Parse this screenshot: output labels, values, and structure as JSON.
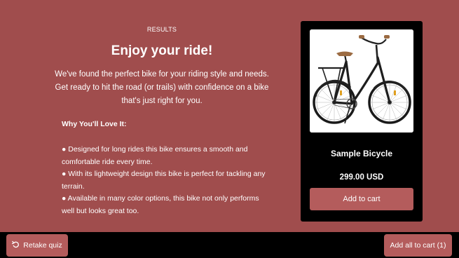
{
  "results": {
    "eyebrow": "RESULTS",
    "title": "Enjoy your ride!",
    "intro": "We've found the perfect bike for your riding style and needs. Get ready to hit the road (or trails) with confidence on a bike that's just right for you.",
    "why_heading": "Why You'll Love It:",
    "bullets": [
      "● Designed for long rides this bike ensures a smooth and comfortable ride every time.",
      "● With its lightweight design this bike is perfect for tackling any terrain.",
      "● Available in many color options, this bike not only performs well but looks great too."
    ]
  },
  "product": {
    "image_icon": "bicycle-image",
    "name": "Sample Bicycle",
    "price": "299.00 USD",
    "add_label": "Add to cart"
  },
  "footer": {
    "retake_label": "Retake quiz",
    "retake_icon": "undo-arrow-icon",
    "add_all_label": "Add all to cart (1)"
  },
  "colors": {
    "background": "#a04d4d",
    "button": "#b45c5c",
    "card": "#000000",
    "footer": "#000000"
  }
}
